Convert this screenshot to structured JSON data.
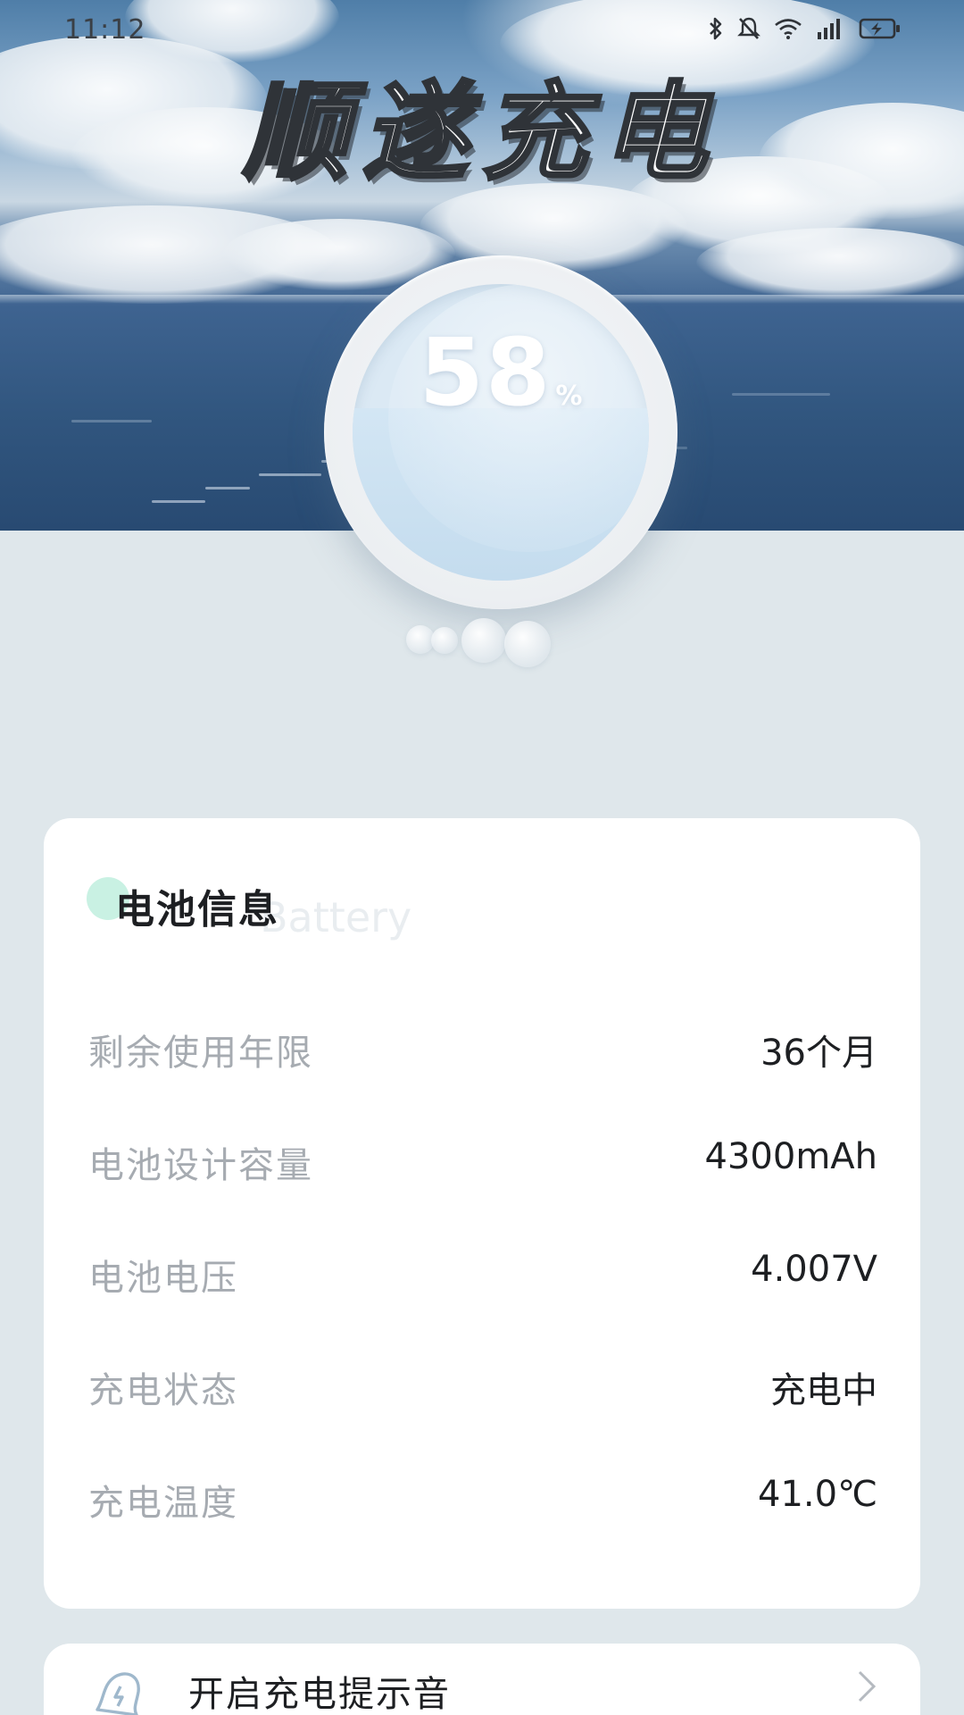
{
  "status_bar": {
    "time": "11:12",
    "icons": [
      "bluetooth-icon",
      "mute-icon",
      "wifi-icon",
      "signal-icon",
      "battery-charging-icon"
    ]
  },
  "header": {
    "title": "顺遂充电"
  },
  "gauge": {
    "percent": 58,
    "value": "58",
    "unit": "%"
  },
  "battery_card": {
    "title": "电池信息",
    "subtitle": "Battery",
    "rows": [
      {
        "label": "剩余使用年限",
        "value": "36个月"
      },
      {
        "label": "电池设计容量",
        "value": "4300mAh"
      },
      {
        "label": "电池电压",
        "value": "4.007V"
      },
      {
        "label": "充电状态",
        "value": "充电中"
      },
      {
        "label": "充电温度",
        "value": "41.0℃"
      }
    ]
  },
  "sound_option": {
    "label": "开启充电提示音",
    "icon": "bell-icon"
  },
  "colors": {
    "background": "#dfe7eb",
    "card": "#ffffff",
    "accent_dot": "#c9f1e3",
    "label_gray": "#a6abb1",
    "value_dark": "#1d1f22"
  }
}
